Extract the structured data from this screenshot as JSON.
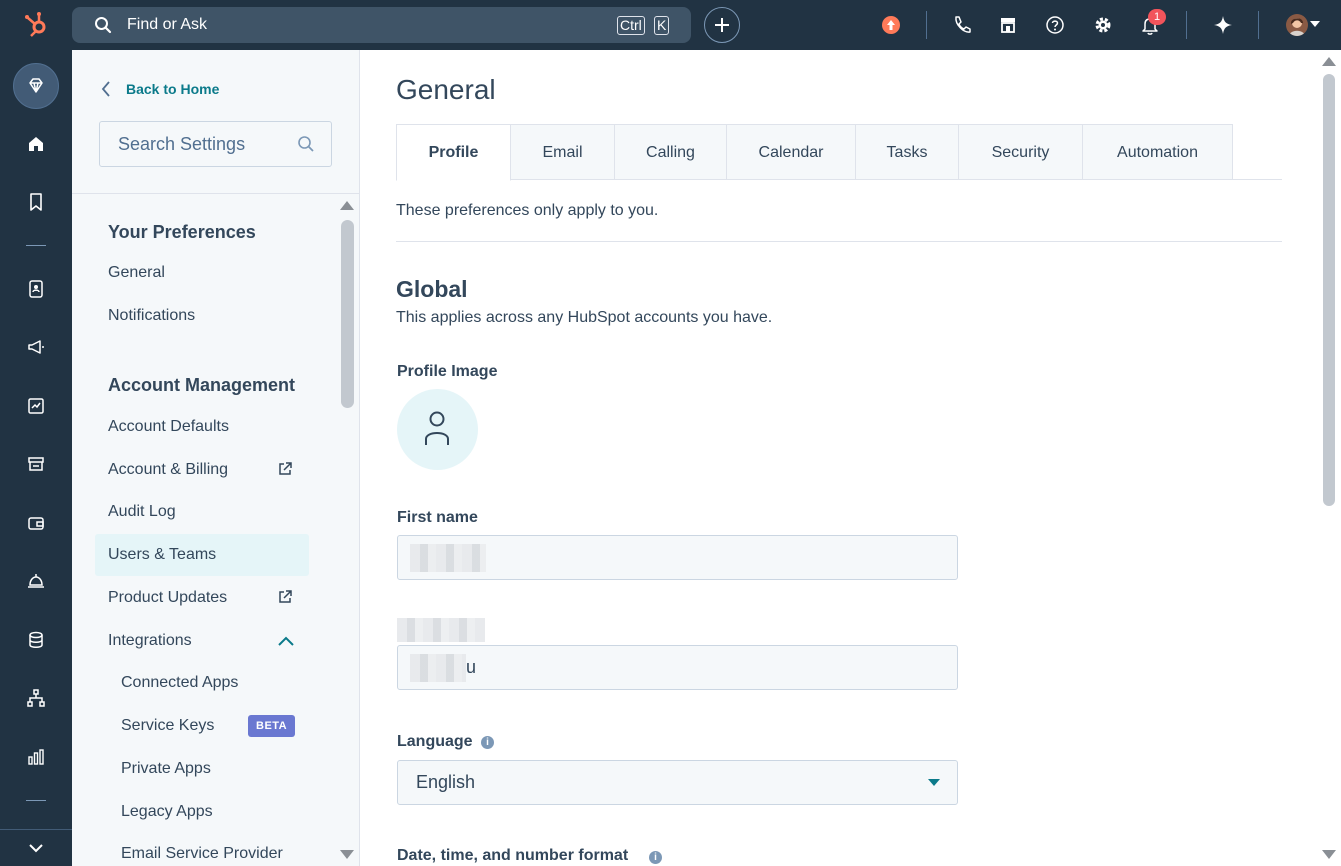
{
  "topbar": {
    "search_label": "Find or Ask",
    "kbd_ctrl": "Ctrl",
    "kbd_k": "K",
    "notification_count": "1"
  },
  "icons": {
    "logo": "hubspot-sprocket-icon",
    "search": "search-icon",
    "add": "plus-icon",
    "upgrade": "upgrade-arrow-icon",
    "calling": "phone-icon",
    "marketplace": "marketplace-icon",
    "help": "help-icon",
    "settings": "gear-icon",
    "notifications": "bell-icon",
    "ai": "sparkle-icon"
  },
  "sidebar": {
    "back_label": "Back to Home",
    "search_placeholder": "Search Settings",
    "sections": [
      {
        "heading": "Your Preferences",
        "items": [
          {
            "label": "General"
          },
          {
            "label": "Notifications"
          }
        ]
      },
      {
        "heading": "Account Management",
        "items": [
          {
            "label": "Account Defaults"
          },
          {
            "label": "Account & Billing",
            "external": true
          },
          {
            "label": "Audit Log"
          },
          {
            "label": "Users & Teams",
            "active": true
          },
          {
            "label": "Product Updates",
            "external": true
          },
          {
            "label": "Integrations",
            "expanded": true
          },
          {
            "label": "Connected Apps",
            "sub": true
          },
          {
            "label": "Service Keys",
            "sub": true,
            "badge": "BETA"
          },
          {
            "label": "Private Apps",
            "sub": true
          },
          {
            "label": "Legacy Apps",
            "sub": true
          },
          {
            "label": "Email Service Provider",
            "sub": true
          }
        ]
      }
    ]
  },
  "main": {
    "title": "General",
    "tabs": [
      {
        "label": "Profile",
        "active": true
      },
      {
        "label": "Email"
      },
      {
        "label": "Calling"
      },
      {
        "label": "Calendar"
      },
      {
        "label": "Tasks"
      },
      {
        "label": "Security"
      },
      {
        "label": "Automation"
      }
    ],
    "intro": "These preferences only apply to you.",
    "section_title": "Global",
    "section_subtitle": "This applies across any HubSpot accounts you have.",
    "profile_image_label": "Profile Image",
    "first_name_label": "First name",
    "last_name_value_visible": "u",
    "language_label": "Language",
    "language_value": "English",
    "date_format_label": "Date, time, and number format"
  },
  "colors": {
    "nav_dark": "#213343",
    "accent_teal": "#0b7a8a",
    "active_item_bg": "#e5f5f8",
    "beta_badge": "#6a78d1",
    "notification_badge": "#f2545b",
    "upgrade": "#ff7a59"
  }
}
